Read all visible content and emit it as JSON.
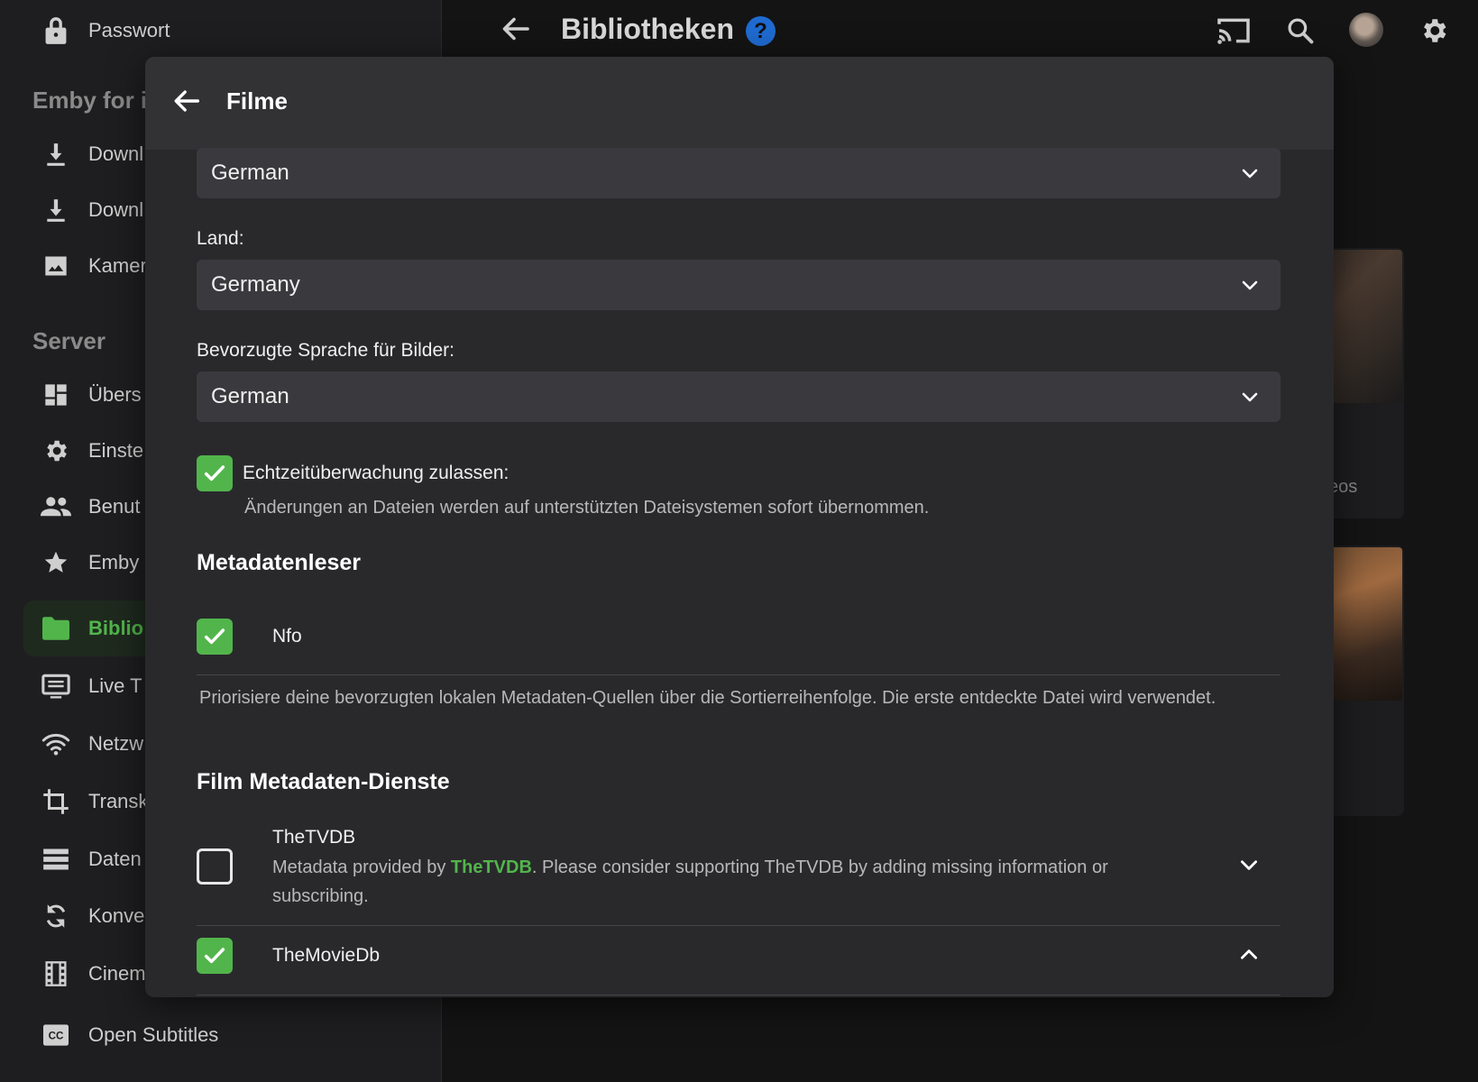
{
  "sidebar": {
    "top_item": "Passwort",
    "section_app": "Emby for i",
    "app_items": [
      "Downl",
      "Downl",
      "Kamer"
    ],
    "section_server": "Server",
    "server_items": [
      "Übers",
      "Einste",
      "Benut",
      "Emby",
      "Biblio",
      "Live T",
      "Netzw",
      "Transk",
      "Daten",
      "Konve",
      "Cinem",
      "Open Subtitles"
    ]
  },
  "topbar": {
    "title": "Bibliotheken",
    "help": "?"
  },
  "background": {
    "card_text": "eos"
  },
  "modal": {
    "title": "Filme",
    "language_select": "German",
    "country_label": "Land:",
    "country_select": "Germany",
    "image_lang_label": "Bevorzugte Sprache für Bilder:",
    "image_lang_select": "German",
    "realtime_label": "Echtzeitüberwachung zulassen:",
    "realtime_desc": "Änderungen an Dateien werden auf unterstützten Dateisystemen sofort übernommen.",
    "metadata_reader_heading": "Metadatenleser",
    "nfo_label": "Nfo",
    "reader_desc": "Priorisiere deine bevorzugten lokalen Metadaten-Quellen über die Sortierreihenfolge. Die erste entdeckte Datei wird verwendet.",
    "movie_services_heading": "Film Metadaten-Dienste",
    "tvdb_name": "TheTVDB",
    "tvdb_desc_before": "Metadata provided by ",
    "tvdb_desc_link": "TheTVDB",
    "tvdb_desc_after": ". Please consider supporting TheTVDB by adding missing information or subscribing.",
    "moviedb_name": "TheMovieDb"
  },
  "colors": {
    "accent": "#52b54b",
    "help": "#1f6bd1"
  }
}
